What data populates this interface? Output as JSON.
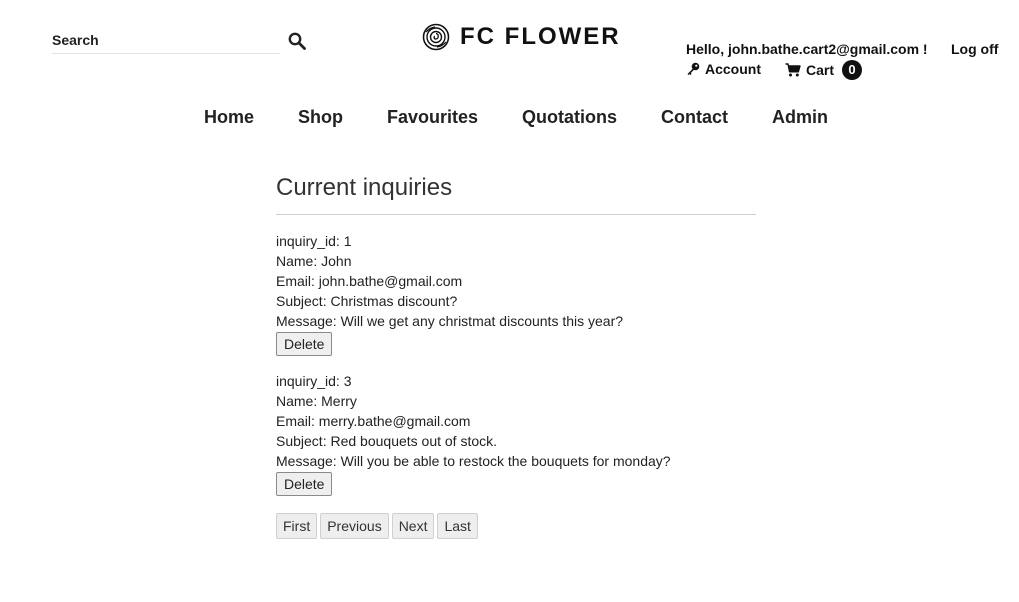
{
  "header": {
    "search": {
      "placeholder": "Search",
      "icon": "search-icon"
    },
    "logo": {
      "text": "FC FLOWER",
      "icon": "rose-logo-icon"
    },
    "user": {
      "greeting": "Hello, john.bathe.cart2@gmail.com !",
      "logoff_label": "Log off",
      "account_label": "Account",
      "account_icon": "key-icon",
      "cart_label": "Cart",
      "cart_icon": "cart-icon",
      "cart_count": "0"
    }
  },
  "nav": {
    "items": [
      {
        "label": "Home"
      },
      {
        "label": "Shop"
      },
      {
        "label": "Favourites"
      },
      {
        "label": "Quotations"
      },
      {
        "label": "Contact"
      },
      {
        "label": "Admin"
      }
    ]
  },
  "main": {
    "title": "Current inquiries",
    "inquiries": [
      {
        "id_line": "inquiry_id: 1",
        "name_line": "Name: John",
        "email_line": "Email: john.bathe@gmail.com",
        "subject_line": "Subject: Christmas discount?",
        "message_line": "Message: Will we get any christmat discounts this year?",
        "delete_label": "Delete"
      },
      {
        "id_line": "inquiry_id: 3",
        "name_line": "Name: Merry",
        "email_line": "Email: merry.bathe@gmail.com",
        "subject_line": "Subject: Red bouquets out of stock.",
        "message_line": "Message: Will you be able to restock the bouquets for monday?",
        "delete_label": "Delete"
      }
    ],
    "pager": {
      "first": "First",
      "previous": "Previous",
      "next": "Next",
      "last": "Last"
    }
  }
}
